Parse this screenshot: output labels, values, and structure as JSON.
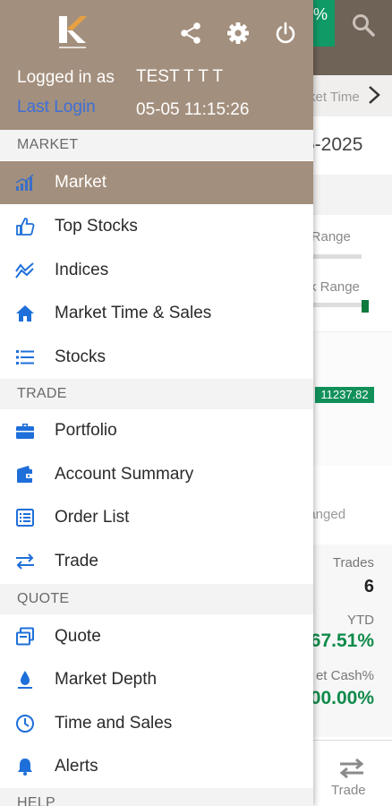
{
  "background_screen": {
    "top_chip_text": "%",
    "market_times_label": "rket Time",
    "date_partial": "5-2025",
    "days_range_label": "s Range",
    "wk_range_label": "Vk Range",
    "price_tag": "11237.82",
    "unchanged_label": "hanged",
    "trades_label": "Trades",
    "trades_value": "6",
    "ytd_label": "YTD",
    "ytd_value": "67.51%",
    "cash_label": "et Cash%",
    "cash_value": "00.00%",
    "bottom_trade_label": "Trade"
  },
  "drawer": {
    "header": {
      "logged_in_label": "Logged in as",
      "user_name": "TEST T T T",
      "last_login_label": "Last Login",
      "last_login_time": "05-05 11:15:26",
      "icons": [
        "share-icon",
        "gear-icon",
        "power-icon"
      ]
    },
    "sections": [
      {
        "title": "MARKET",
        "items": [
          {
            "label": "Market",
            "icon": "bar-chart-icon",
            "active": true
          },
          {
            "label": "Top Stocks",
            "icon": "thumbs-up-icon"
          },
          {
            "label": "Indices",
            "icon": "trend-lines-icon"
          },
          {
            "label": "Market Time & Sales",
            "icon": "home-icon"
          },
          {
            "label": "Stocks",
            "icon": "list-icon"
          }
        ]
      },
      {
        "title": "TRADE",
        "items": [
          {
            "label": "Portfolio",
            "icon": "briefcase-icon"
          },
          {
            "label": "Account Summary",
            "icon": "wallet-icon"
          },
          {
            "label": "Order List",
            "icon": "order-list-icon"
          },
          {
            "label": "Trade",
            "icon": "exchange-arrows-icon"
          }
        ]
      },
      {
        "title": "QUOTE",
        "items": [
          {
            "label": "Quote",
            "icon": "quote-icon"
          },
          {
            "label": "Market Depth",
            "icon": "market-depth-icon"
          },
          {
            "label": "Time and Sales",
            "icon": "clock-icon"
          },
          {
            "label": "Alerts",
            "icon": "bell-icon"
          }
        ]
      },
      {
        "title": "HELP",
        "items": []
      }
    ]
  },
  "colors": {
    "drawer_header_bg": "#a38f7d",
    "active_item_bg": "#a38f7d",
    "icon_blue": "#1e6fd9",
    "link_blue": "#3d6fd8",
    "positive_green": "#0f8a4a"
  }
}
